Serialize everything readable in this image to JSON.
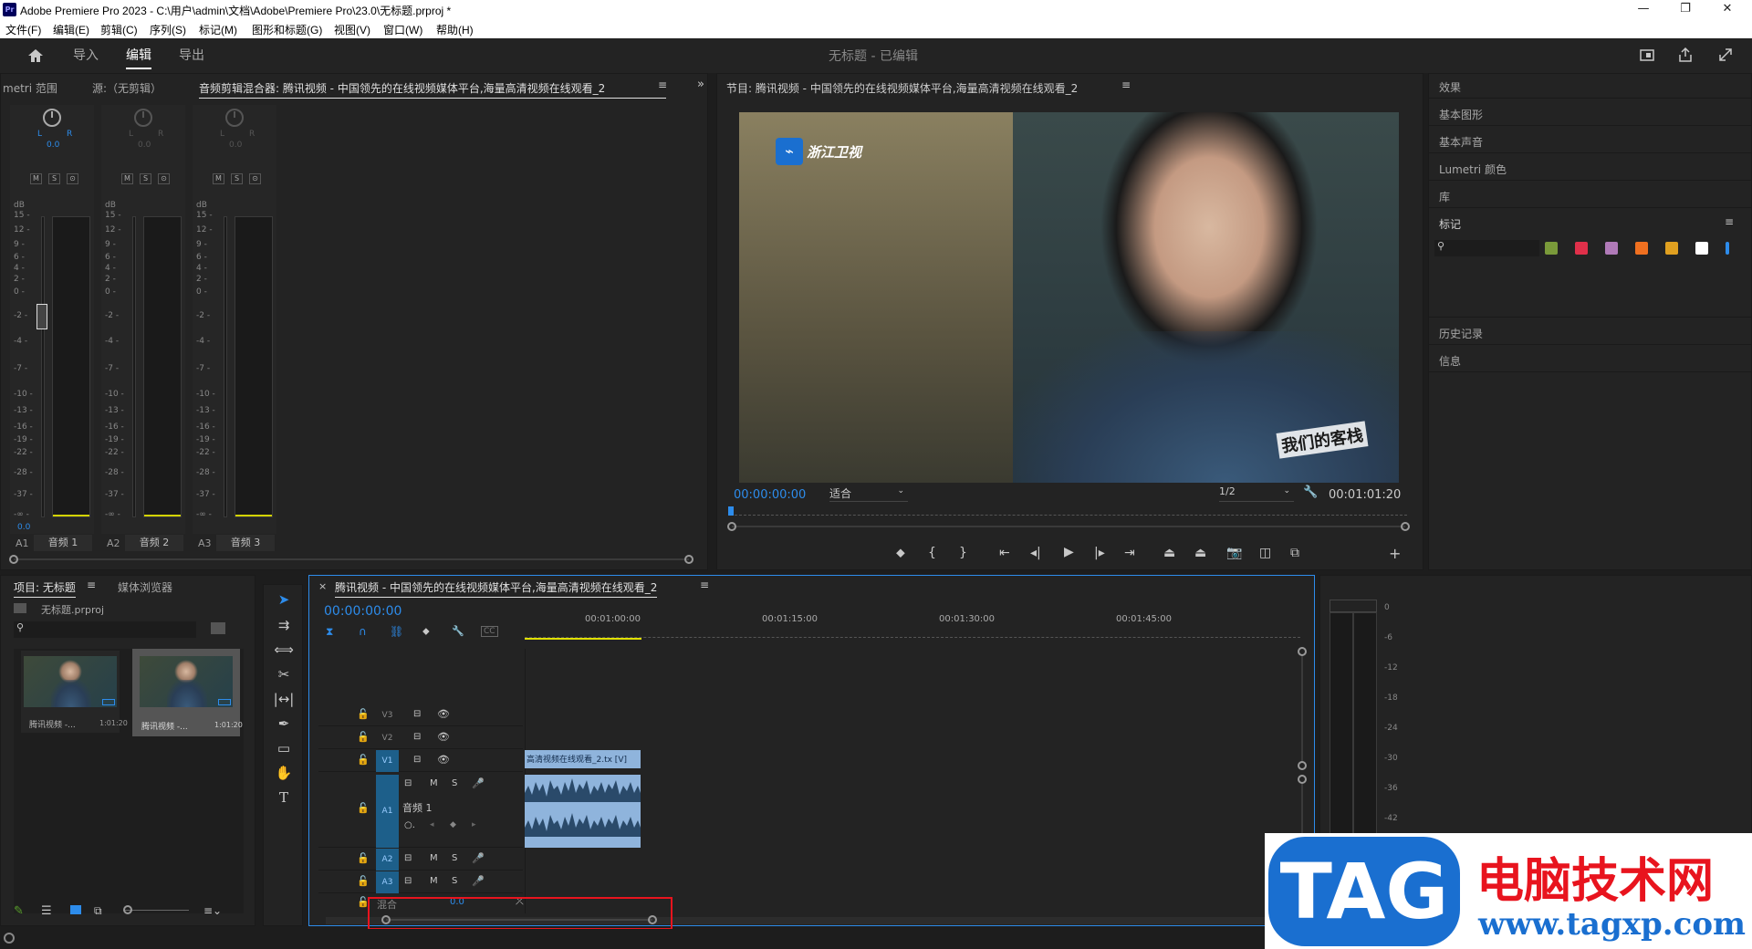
{
  "window": {
    "title": "Adobe Premiere Pro 2023 - C:\\用户\\admin\\文档\\Adobe\\Premiere Pro\\23.0\\无标题.prproj *",
    "app_icon": "Pr",
    "minimize": "—",
    "restore": "❐",
    "close": "✕"
  },
  "menu": [
    "文件(F)",
    "编辑(E)",
    "剪辑(C)",
    "序列(S)",
    "标记(M)",
    "图形和标题(G)",
    "视图(V)",
    "窗口(W)",
    "帮助(H)"
  ],
  "nav": {
    "home_icon": "home-icon",
    "import": "导入",
    "edit": "编辑",
    "export": "导出",
    "project_status": "无标题 - 已编辑"
  },
  "top_left_tabs": {
    "lumetri": "metri 范围",
    "source": "源:（无剪辑）",
    "mixer": "音频剪辑混合器: 腾讯视频 - 中国领先的在线视频媒体平台,海量高清视频在线观看_2"
  },
  "mixer": {
    "db_label": "dB",
    "pan_l": "L",
    "pan_r": "R",
    "pan_value": "0.0",
    "mute": "M",
    "solo": "S",
    "record": "⊙",
    "db_ticks": [
      "15 -",
      "12 -",
      "9 -",
      "6 -",
      "4 -",
      "2 -",
      "0 -",
      "-2 -",
      "-4 -",
      "-7 -",
      "-10 -",
      "-13 -",
      "-16 -",
      "-19 -",
      "-22 -",
      "-28 -",
      "-37 -",
      "-∞ -"
    ],
    "level_value": "0.0",
    "channels": [
      {
        "id": "A1",
        "name": "音频 1"
      },
      {
        "id": "A2",
        "name": "音频 2"
      },
      {
        "id": "A3",
        "name": "音频 3"
      }
    ]
  },
  "program": {
    "title": "节目: 腾讯视频 - 中国领先的在线视频媒体平台,海量高清视频在线观看_2",
    "timecode": "00:00:00:00",
    "fit": "适合",
    "resolution": "1/2",
    "duration": "00:01:01:20",
    "watermark_channel": "浙江卫视",
    "watermark_show": "我们的客栈"
  },
  "transport": [
    "marker-icon",
    "mark-in-icon",
    "mark-out-icon",
    "go-to-in-icon",
    "step-back-icon",
    "play-icon",
    "step-forward-icon",
    "go-to-out-icon",
    "lift-icon",
    "extract-icon",
    "export-frame-icon",
    "comparison-view-icon",
    "button-editor-icon",
    "add-icon"
  ],
  "right_panel": {
    "items": [
      "效果",
      "基本图形",
      "基本声音",
      "Lumetri 颜色",
      "库",
      "标记",
      "历史记录",
      "信息"
    ],
    "swatch_colors": [
      "#7a9a3a",
      "#e0304a",
      "#b07ab8",
      "#f07020",
      "#e0a020",
      "#ffffff",
      "#2d8ceb"
    ]
  },
  "project": {
    "tab": "项目: 无标题",
    "media_browser": "媒体浏览器",
    "file": "无标题.prproj",
    "clips": [
      {
        "name": "腾讯视频 -...",
        "duration": "1:01:20"
      },
      {
        "name": "腾讯视频 -...",
        "duration": "1:01:20"
      }
    ]
  },
  "timeline": {
    "title": "腾讯视频 - 中国领先的在线视频媒体平台,海量高清视频在线观看_2",
    "timecode": "00:00:00:00",
    "ruler": [
      "00:01:00:00",
      "00:01:15:00",
      "00:01:30:00",
      "00:01:45:00"
    ],
    "tracks": {
      "v3": "V3",
      "v2": "V2",
      "v1": "V1",
      "a1": "A1",
      "a1_name": "音频 1",
      "a2": "A2",
      "a3": "A3",
      "mix": "混合",
      "mix_value": "0.0"
    },
    "video_clip": "高清视频在线观看_2.tx [V]",
    "m": "M",
    "s": "S"
  },
  "audio_meter": {
    "ticks": [
      "0",
      "-6",
      "-12",
      "-18",
      "-24",
      "-30",
      "-36",
      "-42"
    ]
  },
  "watermark": {
    "logo": "TAG",
    "site_name": "电脑技术网",
    "url": "www.tagxp.com"
  }
}
